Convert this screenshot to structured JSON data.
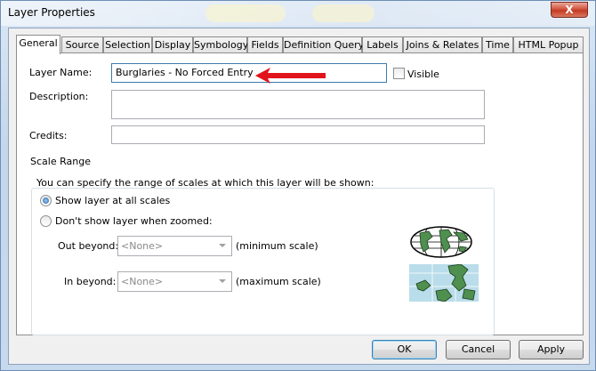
{
  "window": {
    "title": "Layer Properties",
    "close_symbol": "X"
  },
  "tabs": [
    {
      "label": "General",
      "active": true
    },
    {
      "label": "Source"
    },
    {
      "label": "Selection"
    },
    {
      "label": "Display"
    },
    {
      "label": "Symbology"
    },
    {
      "label": "Fields"
    },
    {
      "label": "Definition Query"
    },
    {
      "label": "Labels"
    },
    {
      "label": "Joins & Relates"
    },
    {
      "label": "Time"
    },
    {
      "label": "HTML Popup"
    }
  ],
  "general": {
    "layer_name_label": "Layer Name:",
    "layer_name_value": "Burglaries - No Forced Entry",
    "visible_label": "Visible",
    "visible_checked": false,
    "description_label": "Description:",
    "description_value": "",
    "credits_label": "Credits:",
    "credits_value": ""
  },
  "annotation": {
    "arrow_color": "#e0141a",
    "icon": "red-arrow-icon"
  },
  "scale_range": {
    "title": "Scale Range",
    "intro": "You can specify the range of scales at which this layer will be shown:",
    "option_all": "Show layer at all scales",
    "option_zoomed": "Don't show layer when zoomed:",
    "selected": "all",
    "out_beyond_label": "Out beyond:",
    "out_beyond_value": "<None>",
    "out_beyond_hint": "(minimum scale)",
    "in_beyond_label": "In beyond:",
    "in_beyond_value": "<None>",
    "in_beyond_hint": "(maximum scale)",
    "icons": [
      "world-globe-icon",
      "zoomed-map-icon"
    ]
  },
  "buttons": {
    "ok": "OK",
    "cancel": "Cancel",
    "apply": "Apply"
  }
}
